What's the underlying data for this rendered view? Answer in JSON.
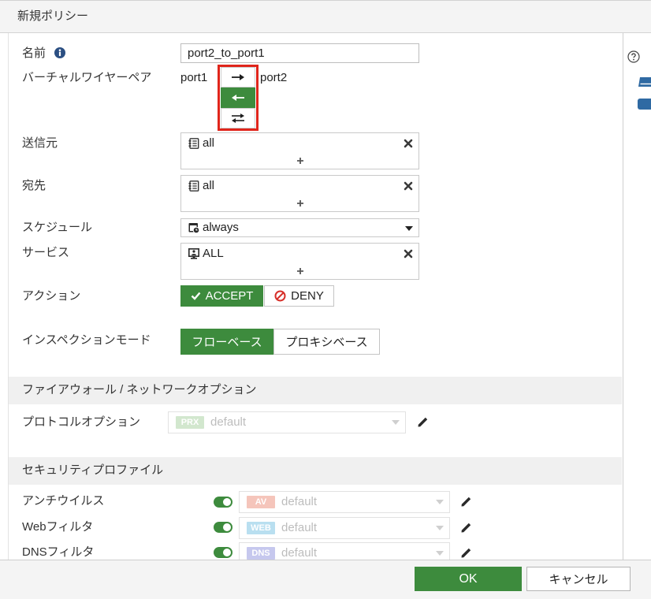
{
  "dialog": {
    "title": "新規ポリシー"
  },
  "form": {
    "name": {
      "label": "名前",
      "value": "port2_to_port1",
      "info_icon": "info-icon"
    },
    "virtual_wire_pair": {
      "label": "バーチャルワイヤーペア",
      "port_left": "port1",
      "port_right": "port2",
      "direction_options": [
        {
          "icon": "arrow-right-icon",
          "selected": false
        },
        {
          "icon": "arrow-left-icon",
          "selected": true
        },
        {
          "icon": "arrow-bidirectional-icon",
          "selected": false
        }
      ]
    },
    "source": {
      "label": "送信元",
      "entries": [
        {
          "icon": "address-icon",
          "value": "all"
        }
      ],
      "add_icon": "plus-icon"
    },
    "destination": {
      "label": "宛先",
      "entries": [
        {
          "icon": "address-icon",
          "value": "all"
        }
      ],
      "add_icon": "plus-icon"
    },
    "schedule": {
      "label": "スケジュール",
      "value": "always",
      "icon": "schedule-icon"
    },
    "service": {
      "label": "サービス",
      "entries": [
        {
          "icon": "service-icon",
          "value": "ALL"
        }
      ],
      "add_icon": "plus-icon"
    },
    "action": {
      "label": "アクション",
      "options": [
        {
          "label": "ACCEPT",
          "icon": "check-icon",
          "selected": true
        },
        {
          "label": "DENY",
          "icon": "deny-icon",
          "selected": false
        }
      ]
    },
    "inspection_mode": {
      "label": "インスペクションモード",
      "options": [
        {
          "label": "フローベース",
          "selected": true
        },
        {
          "label": "プロキシベース",
          "selected": false
        }
      ]
    }
  },
  "firewall_options": {
    "title": "ファイアウォール / ネットワークオプション",
    "protocol_options": {
      "label": "プロトコルオプション",
      "badge": "PRX",
      "badge_color": "#d2e7ce",
      "value": "default",
      "disabled": true
    }
  },
  "security_profiles": {
    "title": "セキュリティプロファイル",
    "items": [
      {
        "label": "アンチウイルス",
        "enabled": true,
        "badge": "AV",
        "badge_color": "#f5c5bb",
        "value": "default"
      },
      {
        "label": "Webフィルタ",
        "enabled": true,
        "badge": "WEB",
        "badge_color": "#b9dff0",
        "value": "default"
      },
      {
        "label": "DNSフィルタ",
        "enabled": true,
        "badge": "DNS",
        "badge_color": "#c6c8ee",
        "value": "default"
      }
    ]
  },
  "footer": {
    "ok_label": "OK",
    "cancel_label": "キャンセル"
  },
  "side_panel": {
    "icons": [
      "help-icon",
      "document-icon",
      "status-dot-icon"
    ]
  },
  "colors": {
    "accent": "#3d8b3d",
    "highlight": "#e0251b",
    "deny": "#d7302a",
    "side_icon": "#2f6aa3"
  }
}
